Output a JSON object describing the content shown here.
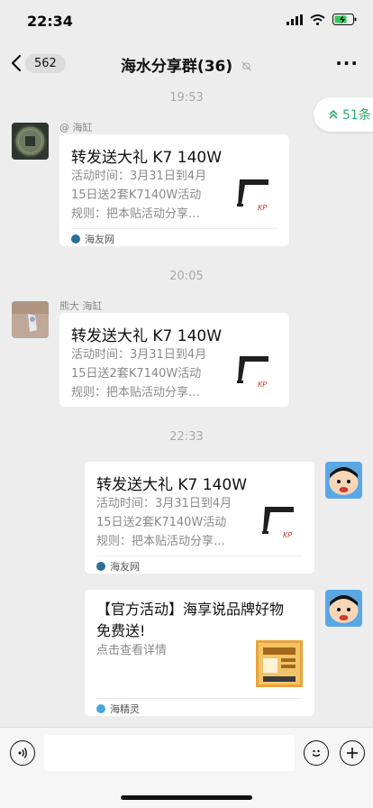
{
  "status_bar": {
    "time": "22:34"
  },
  "nav": {
    "back_count": "562",
    "title": "海水分享群(36)"
  },
  "unread": {
    "label": "51条"
  },
  "timestamps": [
    "19:53",
    "20:05",
    "22:33"
  ],
  "messages": [
    {
      "sender": "@ 海缸",
      "card": {
        "title": "转发送大礼 K7 140W",
        "desc_lines": [
          "活动时间：3月31日到4月",
          "15日送2套K7140W活动",
          "规则：把本贴活动分享…"
        ],
        "thumb_caption": "KP",
        "source": "海友网"
      }
    },
    {
      "sender": "熊大 海缸",
      "card": {
        "title": "转发送大礼 K7 140W",
        "desc_lines": [
          "活动时间：3月31日到4月",
          "15日送2套K7140W活动",
          "规则：把本贴活动分享…"
        ],
        "thumb_caption": "KP"
      }
    },
    {
      "sender": "",
      "card": {
        "title": "转发送大礼 K7 140W",
        "desc_lines": [
          "活动时间：3月31日到4月",
          "15日送2套K7140W活动",
          "规则：把本贴活动分享…"
        ],
        "thumb_caption": "KP",
        "source": "海友网"
      }
    },
    {
      "sender": "",
      "card": {
        "title_lines": [
          "【官方活动】海享说品牌好物",
          "免费送!"
        ],
        "desc": "点击查看详情",
        "source": "海精灵"
      }
    }
  ],
  "colors": {
    "background": "#ededed",
    "accent_green": "#2aae67",
    "card": "#ffffff"
  },
  "icons": [
    "back-chevron-icon",
    "mute-bell-icon",
    "more-icon",
    "double-chevron-up-icon",
    "voice-icon",
    "emoji-icon",
    "plus-icon",
    "signal-icon",
    "wifi-icon",
    "battery-icon"
  ]
}
